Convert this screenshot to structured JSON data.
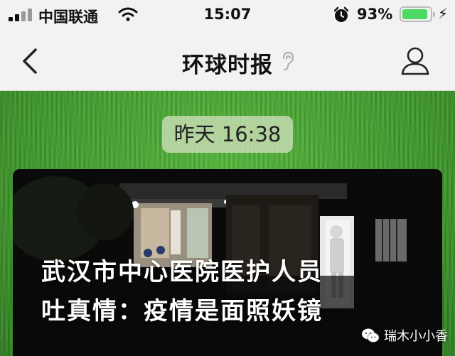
{
  "status_bar": {
    "carrier": "中国联通",
    "time": "15:07",
    "battery_percent": "93%",
    "battery_level": 0.93,
    "icons": [
      "signal-icon",
      "wifi-icon",
      "alarm-icon",
      "battery-icon",
      "charging-icon"
    ]
  },
  "nav": {
    "title": "环球时报",
    "back_icon": "chevron-left-icon",
    "listen_icon": "ear-icon",
    "profile_icon": "person-icon"
  },
  "chat": {
    "timestamp": "昨天 16:38",
    "article": {
      "headline_line1": "武汉市中心医院医护人员",
      "headline_line2": "吐真情：疫情是面照妖镜"
    }
  },
  "watermark": {
    "text": "瑞木小小香"
  },
  "colors": {
    "bar_bg": "#f2f2f2",
    "grass": "#3f9a2c",
    "battery_fill": "#4cd964"
  }
}
